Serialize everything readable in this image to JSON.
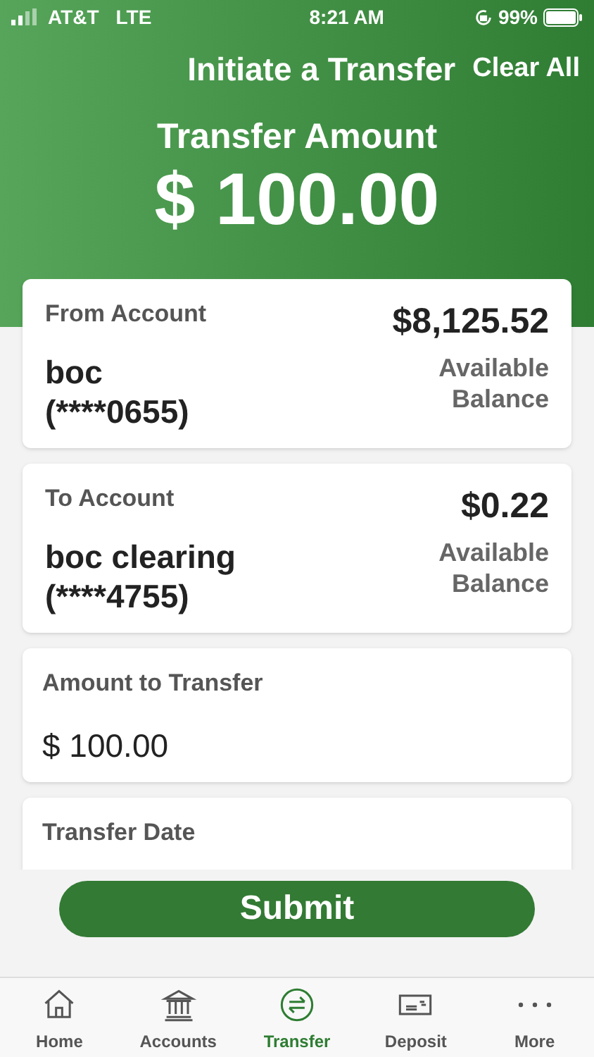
{
  "status_bar": {
    "carrier": "AT&T",
    "network": "LTE",
    "time": "8:21 AM",
    "battery": "99%"
  },
  "header": {
    "title": "Initiate a Transfer",
    "clear_button": "Clear All",
    "amount_label": "Transfer Amount",
    "amount": "$ 100.00"
  },
  "accounts": [
    {
      "label": "From Account",
      "name": "boc",
      "number": "(****0655)",
      "balance": "$8,125.52",
      "balance_label": "Available Balance"
    },
    {
      "label": "To Account",
      "name": "boc clearing",
      "number": "(****4755)",
      "balance": "$0.22",
      "balance_label": "Available Balance"
    }
  ],
  "amount_field": {
    "label": "Amount to Transfer",
    "value": "$ 100.00"
  },
  "date_field": {
    "label": "Transfer Date"
  },
  "submit_button": "Submit",
  "tabs": [
    {
      "label": "Home",
      "kind": "home",
      "selected": false
    },
    {
      "label": "Accounts",
      "kind": "bank",
      "selected": false
    },
    {
      "label": "Transfer",
      "kind": "transfer",
      "selected": true
    },
    {
      "label": "Deposit",
      "kind": "check",
      "selected": false
    },
    {
      "label": "More",
      "kind": "more",
      "selected": false
    }
  ]
}
